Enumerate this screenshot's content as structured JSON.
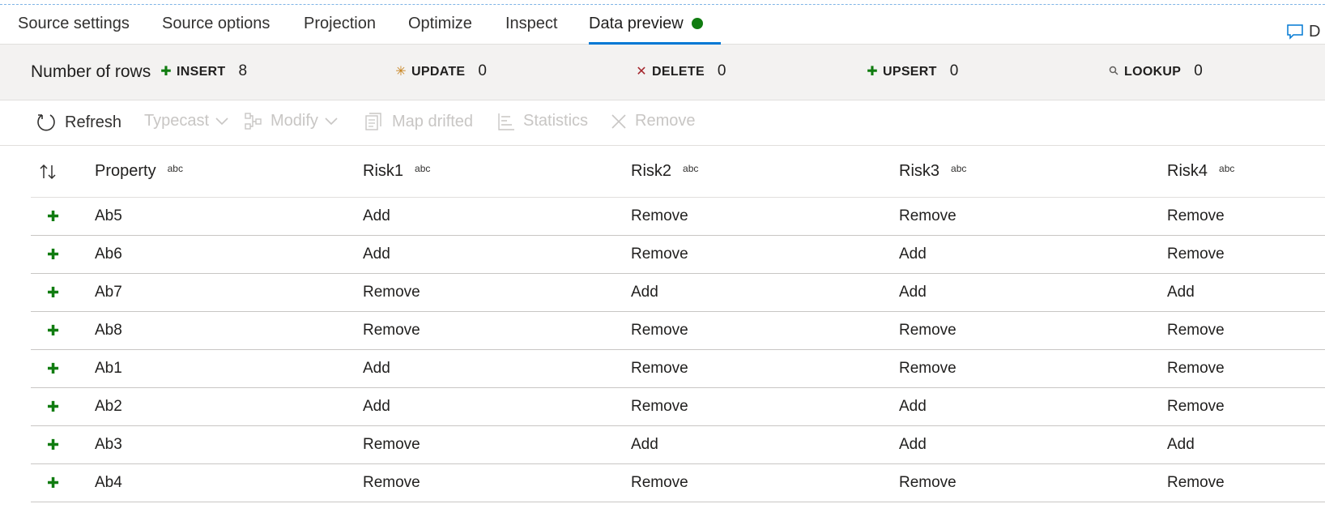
{
  "tabs": [
    {
      "label": "Source settings"
    },
    {
      "label": "Source options"
    },
    {
      "label": "Projection"
    },
    {
      "label": "Optimize"
    },
    {
      "label": "Inspect"
    },
    {
      "label": "Data preview",
      "active": true
    }
  ],
  "status_color": "#107c10",
  "accent_color": "#0078d4",
  "chat_label_partial": "D",
  "stats": {
    "label": "Number of rows",
    "items": [
      {
        "icon": "insert-plus-icon",
        "name": "INSERT",
        "value": "8",
        "color": "#107c10"
      },
      {
        "icon": "update-asterisk-icon",
        "name": "UPDATE",
        "value": "0",
        "color": "#c7821b"
      },
      {
        "icon": "delete-x-icon",
        "name": "DELETE",
        "value": "0",
        "color": "#a4262c"
      },
      {
        "icon": "upsert-icon",
        "name": "UPSERT",
        "value": "0",
        "color": "#107c10"
      },
      {
        "icon": "lookup-search-icon",
        "name": "LOOKUP",
        "value": "0",
        "color": "#605e5c"
      }
    ]
  },
  "toolbar": {
    "refresh": "Refresh",
    "typecast": "Typecast",
    "modify": "Modify",
    "map_drifted": "Map drifted",
    "statistics": "Statistics",
    "remove": "Remove"
  },
  "table": {
    "type_tag": "abc",
    "columns": [
      "Property",
      "Risk1",
      "Risk2",
      "Risk3",
      "Risk4"
    ],
    "rows": [
      [
        "Ab5",
        "Add",
        "Remove",
        "Remove",
        "Remove"
      ],
      [
        "Ab6",
        "Add",
        "Remove",
        "Add",
        "Remove"
      ],
      [
        "Ab7",
        "Remove",
        "Add",
        "Add",
        "Add"
      ],
      [
        "Ab8",
        "Remove",
        "Remove",
        "Remove",
        "Remove"
      ],
      [
        "Ab1",
        "Add",
        "Remove",
        "Remove",
        "Remove"
      ],
      [
        "Ab2",
        "Add",
        "Remove",
        "Add",
        "Remove"
      ],
      [
        "Ab3",
        "Remove",
        "Add",
        "Add",
        "Add"
      ],
      [
        "Ab4",
        "Remove",
        "Remove",
        "Remove",
        "Remove"
      ]
    ]
  }
}
